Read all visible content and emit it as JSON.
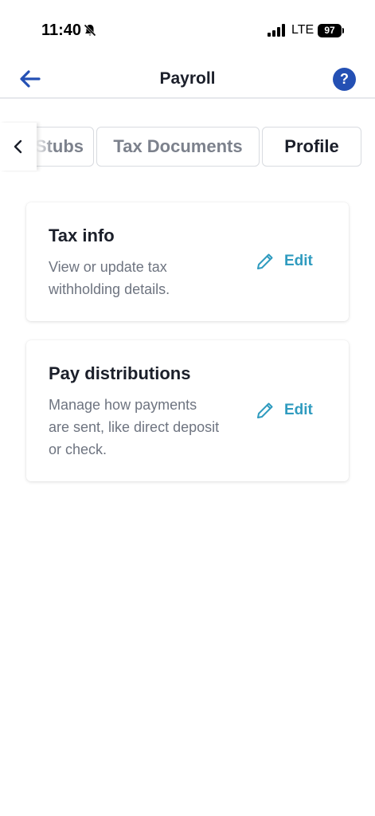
{
  "status_bar": {
    "time": "11:40",
    "network": "LTE",
    "battery": "97"
  },
  "header": {
    "title": "Payroll",
    "help_label": "?"
  },
  "tabs": [
    {
      "label": "Stubs"
    },
    {
      "label": "Tax Documents"
    },
    {
      "label": "Profile"
    }
  ],
  "cards": [
    {
      "title": "Tax info",
      "description": "View or update tax withholding details.",
      "edit_label": "Edit"
    },
    {
      "title": "Pay distributions",
      "description": "Manage how payments are sent, like direct deposit or check.",
      "edit_label": "Edit"
    }
  ],
  "colors": {
    "primary_blue": "#2450b4",
    "edit_teal": "#2f9bbf",
    "muted_text": "#6e7480"
  },
  "icons": [
    "bell-muted-icon",
    "signal-icon",
    "back-arrow-icon",
    "help-icon",
    "chevron-left-icon",
    "pencil-icon"
  ]
}
